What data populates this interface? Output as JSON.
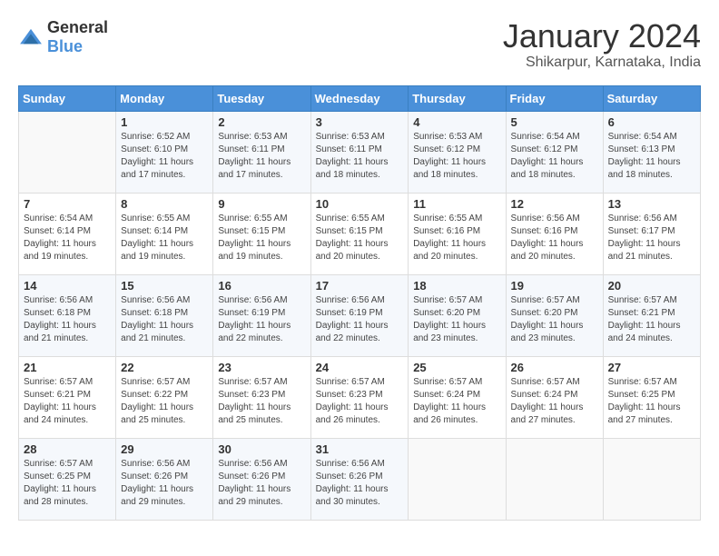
{
  "logo": {
    "general": "General",
    "blue": "Blue"
  },
  "header": {
    "month": "January 2024",
    "location": "Shikarpur, Karnataka, India"
  },
  "weekdays": [
    "Sunday",
    "Monday",
    "Tuesday",
    "Wednesday",
    "Thursday",
    "Friday",
    "Saturday"
  ],
  "weeks": [
    [
      {
        "day": "",
        "sunrise": "",
        "sunset": "",
        "daylight": ""
      },
      {
        "day": "1",
        "sunrise": "Sunrise: 6:52 AM",
        "sunset": "Sunset: 6:10 PM",
        "daylight": "Daylight: 11 hours and 17 minutes."
      },
      {
        "day": "2",
        "sunrise": "Sunrise: 6:53 AM",
        "sunset": "Sunset: 6:11 PM",
        "daylight": "Daylight: 11 hours and 17 minutes."
      },
      {
        "day": "3",
        "sunrise": "Sunrise: 6:53 AM",
        "sunset": "Sunset: 6:11 PM",
        "daylight": "Daylight: 11 hours and 18 minutes."
      },
      {
        "day": "4",
        "sunrise": "Sunrise: 6:53 AM",
        "sunset": "Sunset: 6:12 PM",
        "daylight": "Daylight: 11 hours and 18 minutes."
      },
      {
        "day": "5",
        "sunrise": "Sunrise: 6:54 AM",
        "sunset": "Sunset: 6:12 PM",
        "daylight": "Daylight: 11 hours and 18 minutes."
      },
      {
        "day": "6",
        "sunrise": "Sunrise: 6:54 AM",
        "sunset": "Sunset: 6:13 PM",
        "daylight": "Daylight: 11 hours and 18 minutes."
      }
    ],
    [
      {
        "day": "7",
        "sunrise": "Sunrise: 6:54 AM",
        "sunset": "Sunset: 6:14 PM",
        "daylight": "Daylight: 11 hours and 19 minutes."
      },
      {
        "day": "8",
        "sunrise": "Sunrise: 6:55 AM",
        "sunset": "Sunset: 6:14 PM",
        "daylight": "Daylight: 11 hours and 19 minutes."
      },
      {
        "day": "9",
        "sunrise": "Sunrise: 6:55 AM",
        "sunset": "Sunset: 6:15 PM",
        "daylight": "Daylight: 11 hours and 19 minutes."
      },
      {
        "day": "10",
        "sunrise": "Sunrise: 6:55 AM",
        "sunset": "Sunset: 6:15 PM",
        "daylight": "Daylight: 11 hours and 20 minutes."
      },
      {
        "day": "11",
        "sunrise": "Sunrise: 6:55 AM",
        "sunset": "Sunset: 6:16 PM",
        "daylight": "Daylight: 11 hours and 20 minutes."
      },
      {
        "day": "12",
        "sunrise": "Sunrise: 6:56 AM",
        "sunset": "Sunset: 6:16 PM",
        "daylight": "Daylight: 11 hours and 20 minutes."
      },
      {
        "day": "13",
        "sunrise": "Sunrise: 6:56 AM",
        "sunset": "Sunset: 6:17 PM",
        "daylight": "Daylight: 11 hours and 21 minutes."
      }
    ],
    [
      {
        "day": "14",
        "sunrise": "Sunrise: 6:56 AM",
        "sunset": "Sunset: 6:18 PM",
        "daylight": "Daylight: 11 hours and 21 minutes."
      },
      {
        "day": "15",
        "sunrise": "Sunrise: 6:56 AM",
        "sunset": "Sunset: 6:18 PM",
        "daylight": "Daylight: 11 hours and 21 minutes."
      },
      {
        "day": "16",
        "sunrise": "Sunrise: 6:56 AM",
        "sunset": "Sunset: 6:19 PM",
        "daylight": "Daylight: 11 hours and 22 minutes."
      },
      {
        "day": "17",
        "sunrise": "Sunrise: 6:56 AM",
        "sunset": "Sunset: 6:19 PM",
        "daylight": "Daylight: 11 hours and 22 minutes."
      },
      {
        "day": "18",
        "sunrise": "Sunrise: 6:57 AM",
        "sunset": "Sunset: 6:20 PM",
        "daylight": "Daylight: 11 hours and 23 minutes."
      },
      {
        "day": "19",
        "sunrise": "Sunrise: 6:57 AM",
        "sunset": "Sunset: 6:20 PM",
        "daylight": "Daylight: 11 hours and 23 minutes."
      },
      {
        "day": "20",
        "sunrise": "Sunrise: 6:57 AM",
        "sunset": "Sunset: 6:21 PM",
        "daylight": "Daylight: 11 hours and 24 minutes."
      }
    ],
    [
      {
        "day": "21",
        "sunrise": "Sunrise: 6:57 AM",
        "sunset": "Sunset: 6:21 PM",
        "daylight": "Daylight: 11 hours and 24 minutes."
      },
      {
        "day": "22",
        "sunrise": "Sunrise: 6:57 AM",
        "sunset": "Sunset: 6:22 PM",
        "daylight": "Daylight: 11 hours and 25 minutes."
      },
      {
        "day": "23",
        "sunrise": "Sunrise: 6:57 AM",
        "sunset": "Sunset: 6:23 PM",
        "daylight": "Daylight: 11 hours and 25 minutes."
      },
      {
        "day": "24",
        "sunrise": "Sunrise: 6:57 AM",
        "sunset": "Sunset: 6:23 PM",
        "daylight": "Daylight: 11 hours and 26 minutes."
      },
      {
        "day": "25",
        "sunrise": "Sunrise: 6:57 AM",
        "sunset": "Sunset: 6:24 PM",
        "daylight": "Daylight: 11 hours and 26 minutes."
      },
      {
        "day": "26",
        "sunrise": "Sunrise: 6:57 AM",
        "sunset": "Sunset: 6:24 PM",
        "daylight": "Daylight: 11 hours and 27 minutes."
      },
      {
        "day": "27",
        "sunrise": "Sunrise: 6:57 AM",
        "sunset": "Sunset: 6:25 PM",
        "daylight": "Daylight: 11 hours and 27 minutes."
      }
    ],
    [
      {
        "day": "28",
        "sunrise": "Sunrise: 6:57 AM",
        "sunset": "Sunset: 6:25 PM",
        "daylight": "Daylight: 11 hours and 28 minutes."
      },
      {
        "day": "29",
        "sunrise": "Sunrise: 6:56 AM",
        "sunset": "Sunset: 6:26 PM",
        "daylight": "Daylight: 11 hours and 29 minutes."
      },
      {
        "day": "30",
        "sunrise": "Sunrise: 6:56 AM",
        "sunset": "Sunset: 6:26 PM",
        "daylight": "Daylight: 11 hours and 29 minutes."
      },
      {
        "day": "31",
        "sunrise": "Sunrise: 6:56 AM",
        "sunset": "Sunset: 6:26 PM",
        "daylight": "Daylight: 11 hours and 30 minutes."
      },
      {
        "day": "",
        "sunrise": "",
        "sunset": "",
        "daylight": ""
      },
      {
        "day": "",
        "sunrise": "",
        "sunset": "",
        "daylight": ""
      },
      {
        "day": "",
        "sunrise": "",
        "sunset": "",
        "daylight": ""
      }
    ]
  ]
}
